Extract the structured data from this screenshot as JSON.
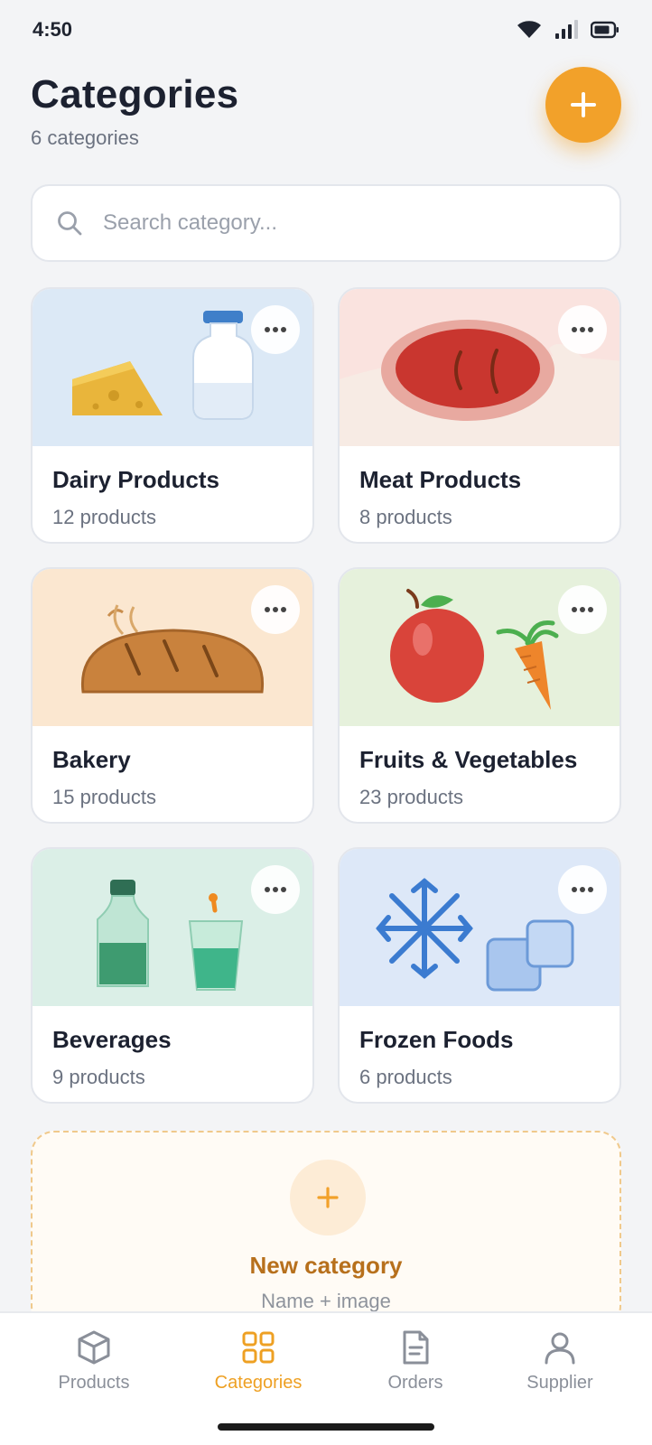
{
  "status": {
    "time": "4:50"
  },
  "header": {
    "title": "Categories",
    "subtitle": "6 categories"
  },
  "search": {
    "placeholder": "Search category...",
    "value": ""
  },
  "categories": [
    {
      "name": "Dairy Products",
      "count": "12 products",
      "icon": "cheese-milk-illustration",
      "bg": "#dce9f6"
    },
    {
      "name": "Meat Products",
      "count": "8 products",
      "icon": "steak-illustration",
      "bg": "#fae3df"
    },
    {
      "name": "Bakery",
      "count": "15 products",
      "icon": "bread-illustration",
      "bg": "#fbe7d0"
    },
    {
      "name": "Fruits & Vegetables",
      "count": "23 products",
      "icon": "apple-carrot-illustration",
      "bg": "#e6f1dc"
    },
    {
      "name": "Beverages",
      "count": "9 products",
      "icon": "bottle-drink-illustration",
      "bg": "#dbefe7"
    },
    {
      "name": "Frozen Foods",
      "count": "6 products",
      "icon": "snowflake-ice-illustration",
      "bg": "#dde8f8"
    }
  ],
  "new_category": {
    "label": "New category",
    "hint": "Name + image"
  },
  "tabs": [
    {
      "label": "Products",
      "icon": "box-icon",
      "active": false
    },
    {
      "label": "Categories",
      "icon": "grid-icon",
      "active": true
    },
    {
      "label": "Orders",
      "icon": "document-icon",
      "active": false
    },
    {
      "label": "Supplier",
      "icon": "user-icon",
      "active": false
    }
  ],
  "colors": {
    "accent": "#f2a12a",
    "background": "#f3f4f6",
    "text": "#1c2130",
    "muted": "#6b7280"
  }
}
